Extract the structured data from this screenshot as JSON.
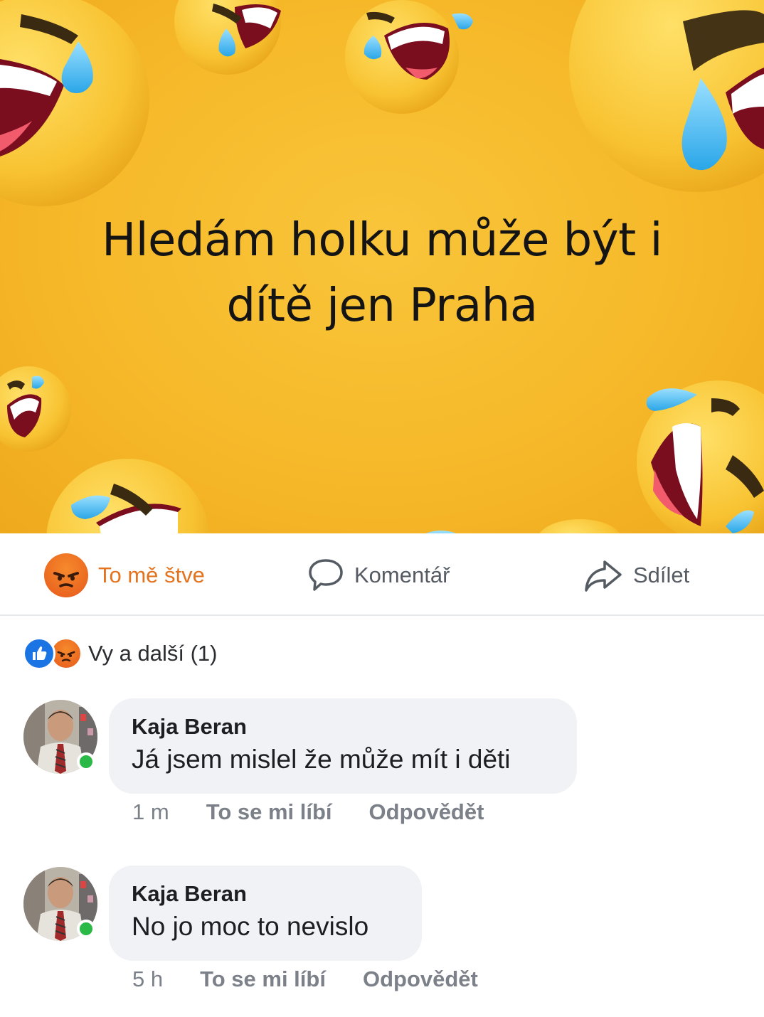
{
  "post": {
    "line1": "Hledám holku může být i",
    "line2": "dítě jen Praha",
    "background_color": "#f6b92a"
  },
  "actions": {
    "react_label": "To mě štve",
    "comment_label": "Komentář",
    "share_label": "Sdílet",
    "react_color": "#e3741f"
  },
  "reactions": {
    "summary": "Vy a další (1)",
    "icons": [
      "like-icon",
      "angry-icon"
    ]
  },
  "comments": [
    {
      "author": "Kaja Beran",
      "text": "Já jsem mislel že může mít i děti",
      "time": "1 m",
      "like_label": "To se mi líbí",
      "reply_label": "Odpovědět",
      "online": true
    },
    {
      "author": "Kaja Beran",
      "text": "No jo moc to nevislo",
      "time": "5 h",
      "like_label": "To se mi líbí",
      "reply_label": "Odpovědět",
      "online": true
    }
  ]
}
